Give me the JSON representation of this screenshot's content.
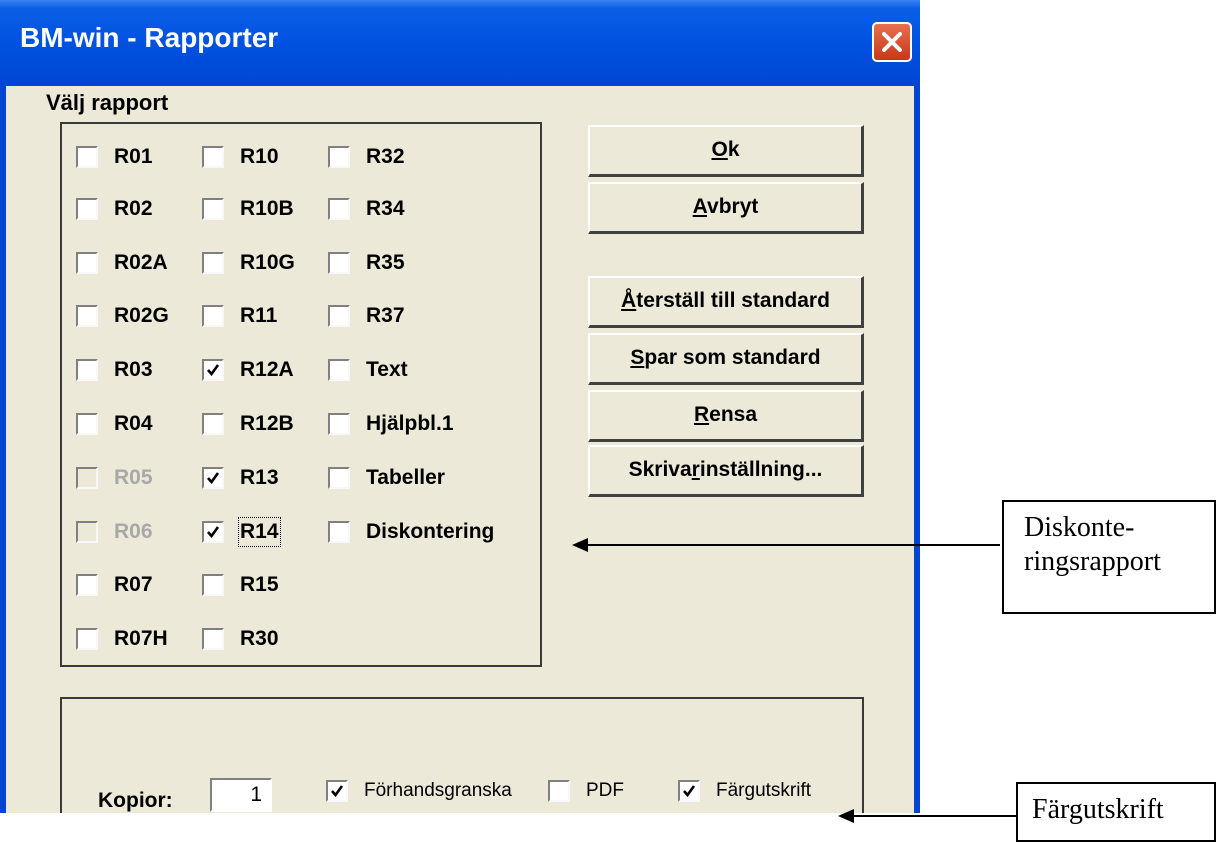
{
  "window": {
    "title": "BM-win - Rapporter"
  },
  "heading": "Välj rapport",
  "reports": [
    {
      "label": "R01",
      "checked": false,
      "disabled": false
    },
    {
      "label": "R02",
      "checked": false,
      "disabled": false
    },
    {
      "label": "R02A",
      "checked": false,
      "disabled": false
    },
    {
      "label": "R02G",
      "checked": false,
      "disabled": false
    },
    {
      "label": "R03",
      "checked": false,
      "disabled": false
    },
    {
      "label": "R04",
      "checked": false,
      "disabled": false
    },
    {
      "label": "R05",
      "checked": false,
      "disabled": true
    },
    {
      "label": "R06",
      "checked": false,
      "disabled": true
    },
    {
      "label": "R07",
      "checked": false,
      "disabled": false
    },
    {
      "label": "R07H",
      "checked": false,
      "disabled": false
    },
    {
      "label": "R10",
      "checked": false,
      "disabled": false
    },
    {
      "label": "R10B",
      "checked": false,
      "disabled": false
    },
    {
      "label": "R10G",
      "checked": false,
      "disabled": false
    },
    {
      "label": "R11",
      "checked": false,
      "disabled": false
    },
    {
      "label": "R12A",
      "checked": true,
      "disabled": false
    },
    {
      "label": "R12B",
      "checked": false,
      "disabled": false
    },
    {
      "label": "R13",
      "checked": true,
      "disabled": false
    },
    {
      "label": "R14",
      "checked": true,
      "disabled": false,
      "focused": true
    },
    {
      "label": "R15",
      "checked": false,
      "disabled": false
    },
    {
      "label": "R30",
      "checked": false,
      "disabled": false
    },
    {
      "label": "R32",
      "checked": false,
      "disabled": false
    },
    {
      "label": "R34",
      "checked": false,
      "disabled": false
    },
    {
      "label": "R35",
      "checked": false,
      "disabled": false
    },
    {
      "label": "R37",
      "checked": false,
      "disabled": false
    },
    {
      "label": "Text",
      "checked": false,
      "disabled": false
    },
    {
      "label": "Hjälpbl.1",
      "checked": false,
      "disabled": false
    },
    {
      "label": "Tabeller",
      "checked": false,
      "disabled": false
    },
    {
      "label": "Diskontering",
      "checked": false,
      "disabled": false
    }
  ],
  "buttons": {
    "ok": {
      "text": "Ok",
      "mnemonic": "O",
      "rest": "k"
    },
    "cancel": {
      "text": "Avbryt",
      "mnemonic": "A",
      "rest": "vbryt"
    },
    "reset": {
      "text": "Återställ till standard",
      "mnemonic": "Å",
      "rest": "terställ till standard"
    },
    "save": {
      "text": "Spar som standard",
      "mnemonic": "S",
      "rest": "par som standard"
    },
    "clear": {
      "text": "Rensa",
      "mnemonic": "R",
      "rest": "ensa"
    },
    "printer": {
      "text": "Skrivarinställning...",
      "before": "Skriva",
      "mnemonic": "r",
      "after": "inställning..."
    }
  },
  "options": {
    "copies_label": "Kopior:",
    "copies_value": "1",
    "preview": {
      "label": "Förhandsgranska",
      "checked": true
    },
    "pdf": {
      "label": "PDF",
      "checked": false
    },
    "color": {
      "label": "Färgutskrift",
      "checked": true
    }
  },
  "annotations": {
    "diskontering": {
      "line1": "Diskonte-",
      "line2": "ringsrapport"
    },
    "color": {
      "text": "Färgutskrift"
    }
  },
  "colors": {
    "titlebar": "#0050e0",
    "dialog_bg": "#ece9d8",
    "close_button": "#d64a2a"
  }
}
